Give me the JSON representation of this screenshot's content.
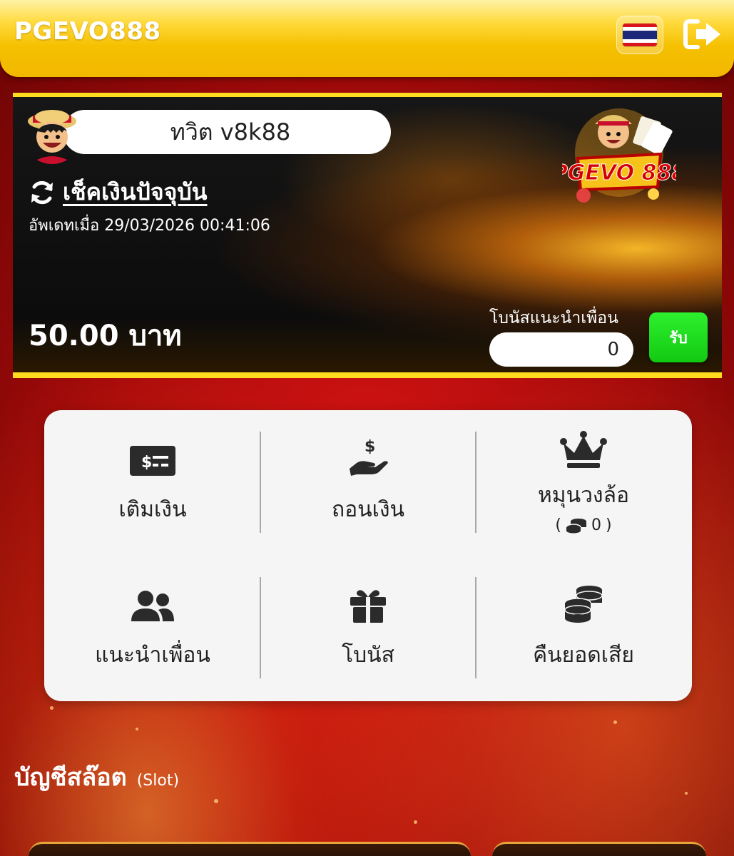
{
  "header": {
    "brand": "PGEVO888",
    "language_flag": "thailand-flag",
    "logout_icon": "sign-out-icon"
  },
  "balance_card": {
    "username": "ทวิต v8k88",
    "refresh_label": "เช็คเงินปัจจุบัน",
    "updated_text": "อัพเดทเมื่อ 29/03/2026 00:41:06",
    "balance": "50.00 บาท",
    "referral_bonus_label": "โบนัสแนะนำเพื่อน",
    "referral_bonus_value": "0",
    "claim_label": "รับ",
    "logo_text": "PGEVO 888"
  },
  "menu": {
    "items": [
      {
        "label": "เติมเงิน",
        "icon": "money-bill-icon"
      },
      {
        "label": "ถอนเงิน",
        "icon": "hand-dollar-icon"
      },
      {
        "label": "หมุนวงล้อ",
        "icon": "crown-icon",
        "sub_open": "(",
        "sub_value": "0",
        "sub_close": ")"
      },
      {
        "label": "แนะนำเพื่อน",
        "icon": "users-icon"
      },
      {
        "label": "โบนัส",
        "icon": "gift-icon"
      },
      {
        "label": "คืนยอดเสีย",
        "icon": "coins-icon"
      }
    ]
  },
  "slot_section": {
    "title": "บัญชีสล๊อต",
    "subtitle": "(Slot)"
  },
  "colors": {
    "header_gold": "#f5c000",
    "card_border": "#ffdc1e",
    "claim_green": "#12c912",
    "background_red": "#c80f0f"
  }
}
